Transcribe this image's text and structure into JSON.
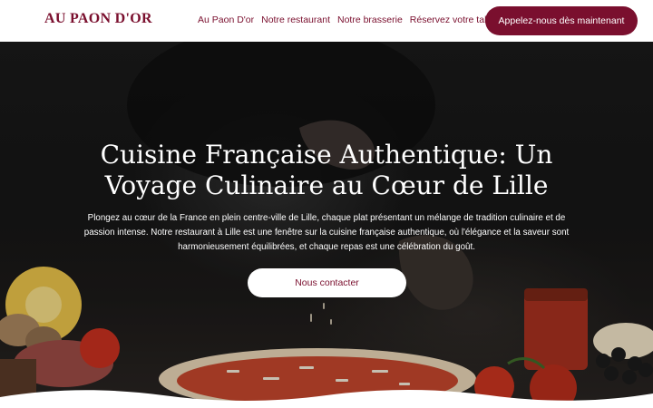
{
  "header": {
    "logo": "AU PAON D'OR",
    "nav": [
      "Au Paon D'or",
      "Notre restaurant",
      "Notre brasserie",
      "Réservez votre table"
    ],
    "call_button": "Appelez-nous dès maintenant"
  },
  "hero": {
    "title": "Cuisine Française Authentique: Un Voyage Culinaire au Cœur de Lille",
    "description": "Plongez au cœur de la France en plein centre-ville de Lille, chaque plat présentant un mélange de tradition culinaire et de passion intense. Notre restaurant à Lille est une fenêtre sur la cuisine française authentique, où l'élégance et la saveur sont harmonieusement équilibrées, et chaque repas est une célébration du goût.",
    "contact_button": "Nous contacter",
    "background_image": "chef-sprinkling-cheese-on-pizza-photo"
  },
  "colors": {
    "brand": "#7a0f2e",
    "header_bg": "#ffffff",
    "hero_overlay": "#1a1a1a",
    "hero_text": "#ffffff"
  }
}
